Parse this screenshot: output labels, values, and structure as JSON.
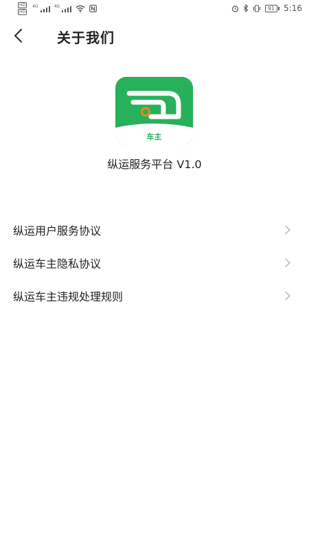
{
  "status_bar": {
    "hd_label": "HD",
    "network_labels": [
      "4G",
      "4G"
    ],
    "battery": "91",
    "time": "5:16"
  },
  "header": {
    "title": "关于我们"
  },
  "app": {
    "logo_caption": "车主",
    "version_text": "纵运服务平台 V1.0",
    "brand_color": "#27b15a"
  },
  "menu": {
    "items": [
      {
        "label": "纵运用户服务协议"
      },
      {
        "label": "纵运车主隐私协议"
      },
      {
        "label": "纵运车主违规处理规则"
      }
    ]
  }
}
